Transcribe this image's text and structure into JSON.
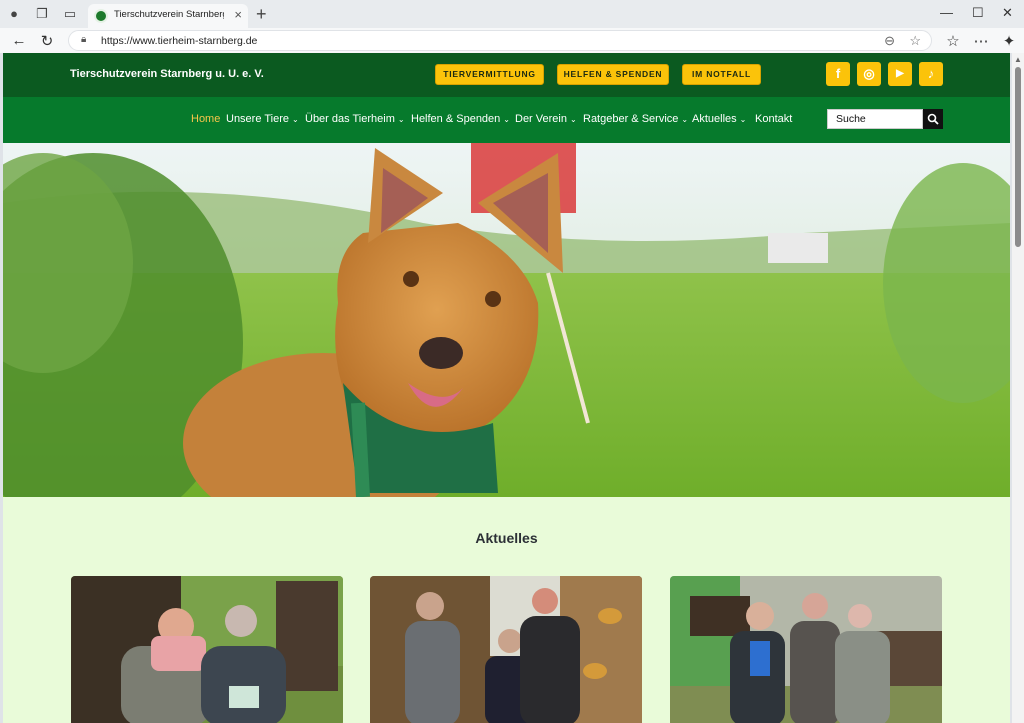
{
  "browser": {
    "tab_title": "Tierschutzverein Starnberg u.U. e.V.",
    "url": "https://www.tierheim-starnberg.de"
  },
  "site": {
    "brand": "Tierschutzverein Starnberg u. U. e. V.",
    "cta_buttons": [
      {
        "label": "TIERVERMITTLUNG"
      },
      {
        "label": "HELFEN & SPENDEN"
      },
      {
        "label": "IM NOTFALL"
      }
    ],
    "social": [
      {
        "icon": "facebook-icon",
        "glyph": "f"
      },
      {
        "icon": "instagram-icon",
        "glyph": "◎"
      },
      {
        "icon": "youtube-icon",
        "glyph": "▶"
      },
      {
        "icon": "tiktok-icon",
        "glyph": "♪"
      }
    ],
    "nav": [
      {
        "label": "Home"
      },
      {
        "label": "Unsere Tiere"
      },
      {
        "label": "Über das Tierheim"
      },
      {
        "label": "Helfen & Spenden"
      },
      {
        "label": "Der Verein"
      },
      {
        "label": "Ratgeber & Service"
      },
      {
        "label": "Aktuelles"
      },
      {
        "label": "Kontakt"
      }
    ],
    "search_placeholder": "Suche",
    "section_heading": "Aktuelles"
  },
  "colors": {
    "topbar": "#0b5a20",
    "navbar": "#067a2c",
    "accent": "#fbc30a",
    "active_nav": "#f6c64a",
    "page_bg": "#e9fbd9"
  }
}
